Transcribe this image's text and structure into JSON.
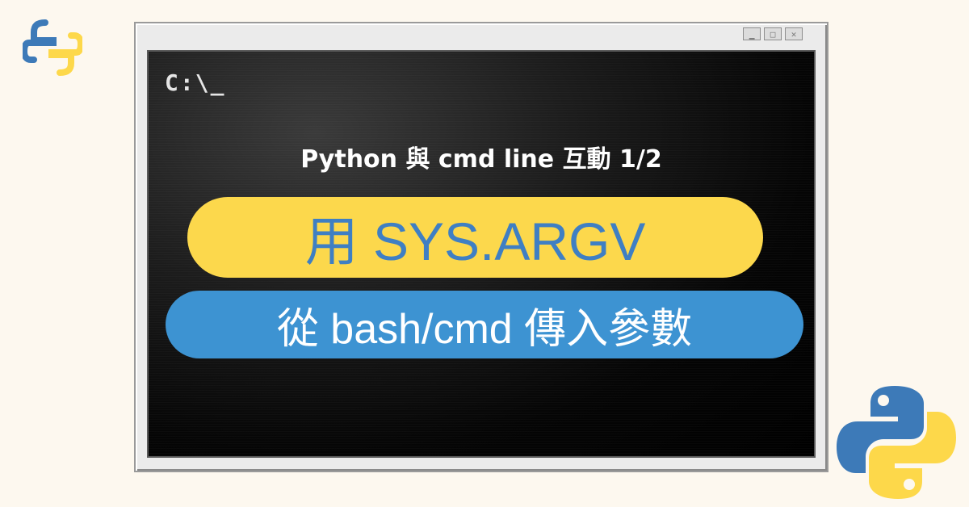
{
  "terminal": {
    "prompt": "C:\\_",
    "subtitle": "Python 與 cmd line 互動 1/2"
  },
  "banner": {
    "main_title": "用 SYS.ARGV",
    "sub_title": "從 bash/cmd 傳入參數"
  },
  "window_buttons": [
    "minimize-icon",
    "maximize-icon",
    "close-icon"
  ],
  "icons": [
    "python-logo-small",
    "python-logo-large"
  ],
  "colors": {
    "background": "#fdf8ef",
    "yellow_pill": "#fcd84c",
    "blue_pill": "#3d93d2",
    "python_blue": "#3d7ab8",
    "python_yellow": "#fdd84a"
  }
}
